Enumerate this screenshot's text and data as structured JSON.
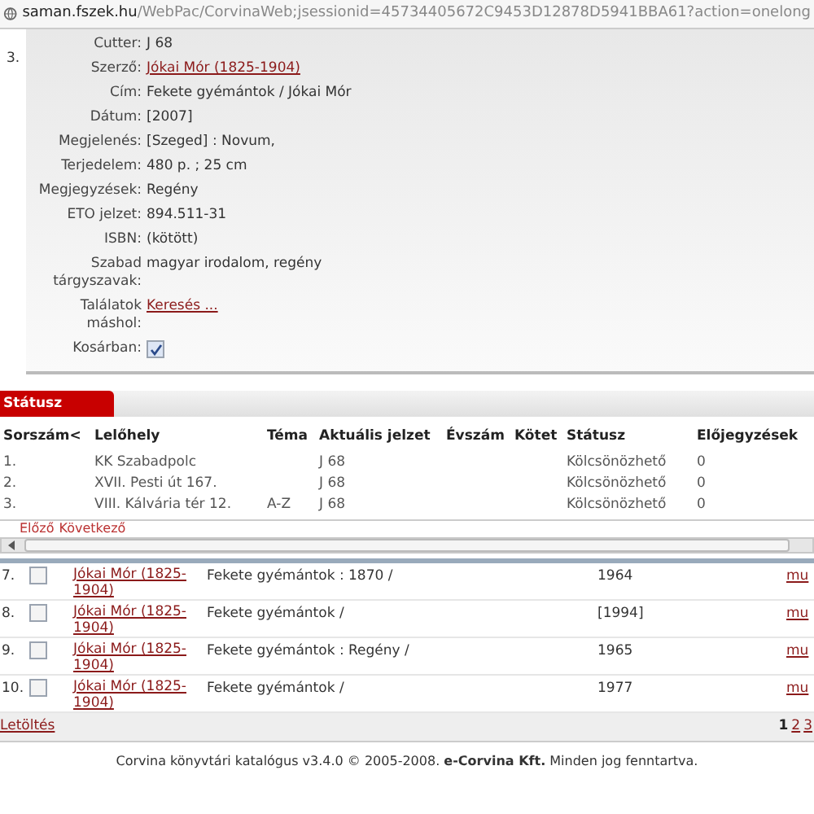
{
  "address_bar": {
    "host": "saman.fszek.hu",
    "path": "/WebPac/CorvinaWeb;jsessionid=45734405672C9453D12878D5941BBA61?action=onelong"
  },
  "record": {
    "number": "3.",
    "fields": [
      {
        "label": "Cutter:",
        "kind": "text",
        "value": "J 68"
      },
      {
        "label": "Szerző:",
        "kind": "link",
        "value": "Jókai Mór (1825-1904)"
      },
      {
        "label": "Cím:",
        "kind": "text",
        "value": "Fekete gyémántok / Jókai Mór"
      },
      {
        "label": "Dátum:",
        "kind": "text",
        "value": "[2007]"
      },
      {
        "label": "Megjelenés:",
        "kind": "text",
        "value": "[Szeged] : Novum,"
      },
      {
        "label": "Terjedelem:",
        "kind": "text",
        "value": "480 p. ; 25 cm"
      },
      {
        "label": "Megjegyzések:",
        "kind": "text",
        "value": "Regény"
      },
      {
        "label": "ETO jelzet:",
        "kind": "text",
        "value": "894.511-31"
      },
      {
        "label": "ISBN:",
        "kind": "text",
        "value": "(kötött)"
      },
      {
        "label": "Szabad tárgyszavak:",
        "kind": "text",
        "value": "magyar irodalom, regény"
      },
      {
        "label": "Találatok máshol:",
        "kind": "link",
        "value": "Keresés ..."
      },
      {
        "label": "Kosárban:",
        "kind": "checkbox",
        "checked": true
      }
    ]
  },
  "status_tab": {
    "label": "Státusz"
  },
  "holdings": {
    "columns": [
      "Sorszám<",
      "Lelőhely",
      "Téma",
      "Aktuális jelzet",
      "Évszám",
      "Kötet",
      "Státusz",
      "Előjegyzések"
    ],
    "rows": [
      [
        "1.",
        "KK Szabadpolc",
        "",
        "J 68",
        "",
        "",
        "Kölcsönözhető",
        "0"
      ],
      [
        "2.",
        "XVII. Pesti út 167.",
        "",
        "J 68",
        "",
        "",
        "Kölcsönözhető",
        "0"
      ],
      [
        "3.",
        "VIII. Kálvária tér 12.",
        "A-Z",
        "J 68",
        "",
        "",
        "Kölcsönözhető",
        "0"
      ]
    ],
    "pager": [
      "Előző",
      "Következő"
    ]
  },
  "results": [
    {
      "number": "7.",
      "checked": false,
      "author": "Jókai Mór (1825-1904)",
      "title": "Fekete gyémántok : 1870 /",
      "year": "1964",
      "link": "mu"
    },
    {
      "number": "8.",
      "checked": false,
      "author": "Jókai Mór (1825-1904)",
      "title": "Fekete gyémántok /",
      "year": "[1994]",
      "link": "mu"
    },
    {
      "number": "9.",
      "checked": false,
      "author": "Jókai Mór (1825-1904)",
      "title": "Fekete gyémántok : Regény /",
      "year": "1965",
      "link": "mu"
    },
    {
      "number": "10.",
      "checked": false,
      "author": "Jókai Mór (1825-1904)",
      "title": "Fekete gyémántok /",
      "year": "1977",
      "link": "mu"
    }
  ],
  "results_footer": {
    "download": "Letöltés",
    "pages": [
      {
        "label": "1",
        "selected": true
      },
      {
        "label": "2",
        "selected": false
      },
      {
        "label": "3",
        "selected": false
      }
    ]
  },
  "footer": "Corvina könyvtári katalógus v3.4.0 © 2005-2008. **e-Corvina Kft.** Minden jog fenntartva."
}
